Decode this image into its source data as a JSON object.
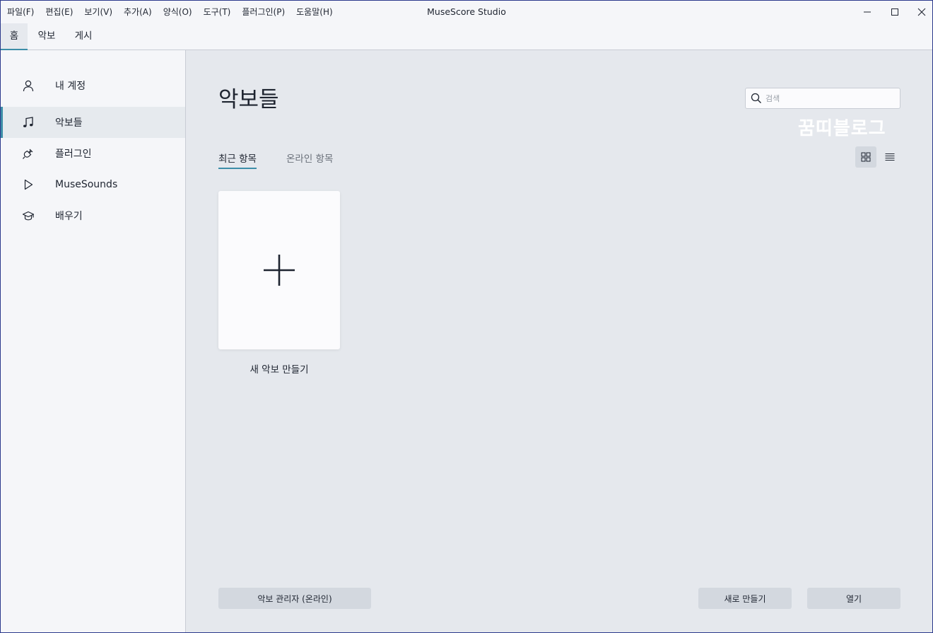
{
  "window": {
    "title": "MuseScore Studio"
  },
  "menu": [
    "파일(F)",
    "편집(E)",
    "보기(V)",
    "추가(A)",
    "양식(O)",
    "도구(T)",
    "플러그인(P)",
    "도움말(H)"
  ],
  "window_controls": {
    "minimize_icon": "minimize-icon",
    "maximize_icon": "maximize-icon",
    "close_icon": "close-icon"
  },
  "top_tabs": [
    {
      "label": "홈",
      "active": true
    },
    {
      "label": "악보",
      "active": false
    },
    {
      "label": "게시",
      "active": false
    }
  ],
  "sidebar": {
    "items": [
      {
        "label": "내 계정",
        "icon": "account-icon",
        "active": false
      },
      {
        "label": "악보들",
        "icon": "music-note-icon",
        "active": true
      },
      {
        "label": "플러그인",
        "icon": "plugin-icon",
        "active": false
      },
      {
        "label": "MuseSounds",
        "icon": "play-icon",
        "active": false
      },
      {
        "label": "배우기",
        "icon": "graduation-cap-icon",
        "active": false
      }
    ]
  },
  "main": {
    "title": "악보들",
    "search": {
      "placeholder": "검색",
      "value": ""
    },
    "watermark": "꿈띠블로그",
    "subtabs": [
      {
        "label": "최근 항목",
        "active": true
      },
      {
        "label": "온라인 항목",
        "active": false
      }
    ],
    "view_modes": {
      "grid_icon": "grid-view-icon",
      "list_icon": "list-view-icon",
      "active": "grid"
    },
    "new_score_card": {
      "label": "새 악보 만들기",
      "icon": "plus-icon"
    },
    "buttons": {
      "score_manager": "악보 관리자 (온라인)",
      "new": "새로 만들기",
      "open": "열기"
    }
  },
  "colors": {
    "accent": "#3d8ea8",
    "background": "#f5f6f9",
    "main_background": "#e5e8ed",
    "button": "#d3d8df",
    "card": "#fbfbfd"
  }
}
